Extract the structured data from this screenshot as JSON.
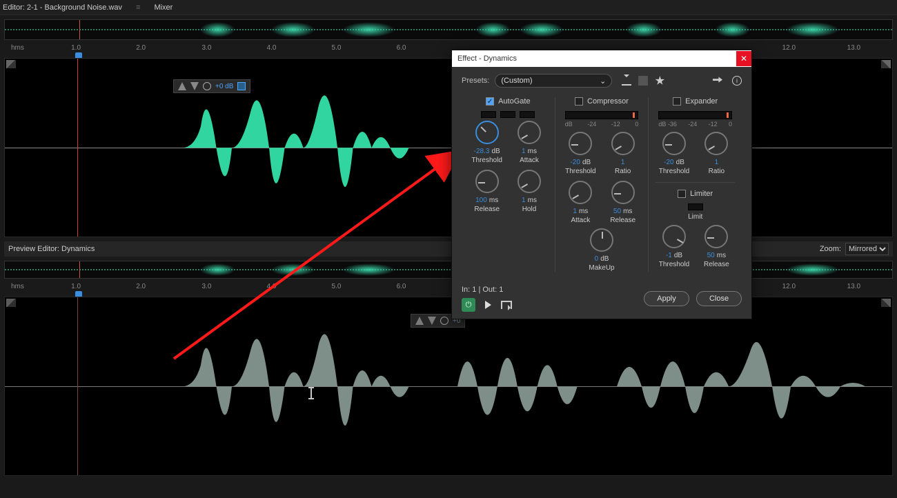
{
  "tabs": {
    "editor": "Editor: 2-1 - Background Noise.wav",
    "mixer": "Mixer"
  },
  "ruler_unit": "hms",
  "ruler_ticks": [
    "1.0",
    "2.0",
    "3.0",
    "4.0",
    "5.0",
    "6.0",
    "12.0",
    "13.0"
  ],
  "hud": {
    "gain": "+0 dB"
  },
  "preview": {
    "title": "Preview Editor: Dynamics",
    "zoom_label": "Zoom:",
    "zoom_value": "Mirrored"
  },
  "dialog": {
    "title": "Effect - Dynamics",
    "presets_label": "Presets:",
    "preset_value": "(Custom)",
    "autogate": {
      "label": "AutoGate",
      "checked": true,
      "threshold": {
        "val": "-28.3",
        "unit": "dB",
        "label": "Threshold"
      },
      "attack": {
        "val": "1",
        "unit": "ms",
        "label": "Attack"
      },
      "release": {
        "val": "100",
        "unit": "ms",
        "label": "Release"
      },
      "hold": {
        "val": "1",
        "unit": "ms",
        "label": "Hold"
      }
    },
    "compressor": {
      "label": "Compressor",
      "checked": false,
      "meter_ticks": [
        "dB",
        "-24",
        "-12",
        "0"
      ],
      "threshold": {
        "val": "-20",
        "unit": "dB",
        "label": "Threshold"
      },
      "ratio": {
        "val": "1",
        "unit": "",
        "label": "Ratio"
      },
      "attack": {
        "val": "1",
        "unit": "ms",
        "label": "Attack"
      },
      "release": {
        "val": "50",
        "unit": "ms",
        "label": "Release"
      },
      "makeup": {
        "val": "0",
        "unit": "dB",
        "label": "MakeUp"
      }
    },
    "expander": {
      "label": "Expander",
      "checked": false,
      "meter_ticks": [
        "dB -36",
        "-24",
        "-12",
        "0"
      ],
      "threshold": {
        "val": "-20",
        "unit": "dB",
        "label": "Threshold"
      },
      "ratio": {
        "val": "1",
        "unit": "",
        "label": "Ratio"
      }
    },
    "limiter": {
      "label": "Limiter",
      "checked": false,
      "limit_label": "Limit",
      "threshold": {
        "val": "-1",
        "unit": "dB",
        "label": "Threshold"
      },
      "release": {
        "val": "50",
        "unit": "ms",
        "label": "Release"
      }
    },
    "io": "In: 1 | Out: 1",
    "apply": "Apply",
    "close": "Close"
  }
}
